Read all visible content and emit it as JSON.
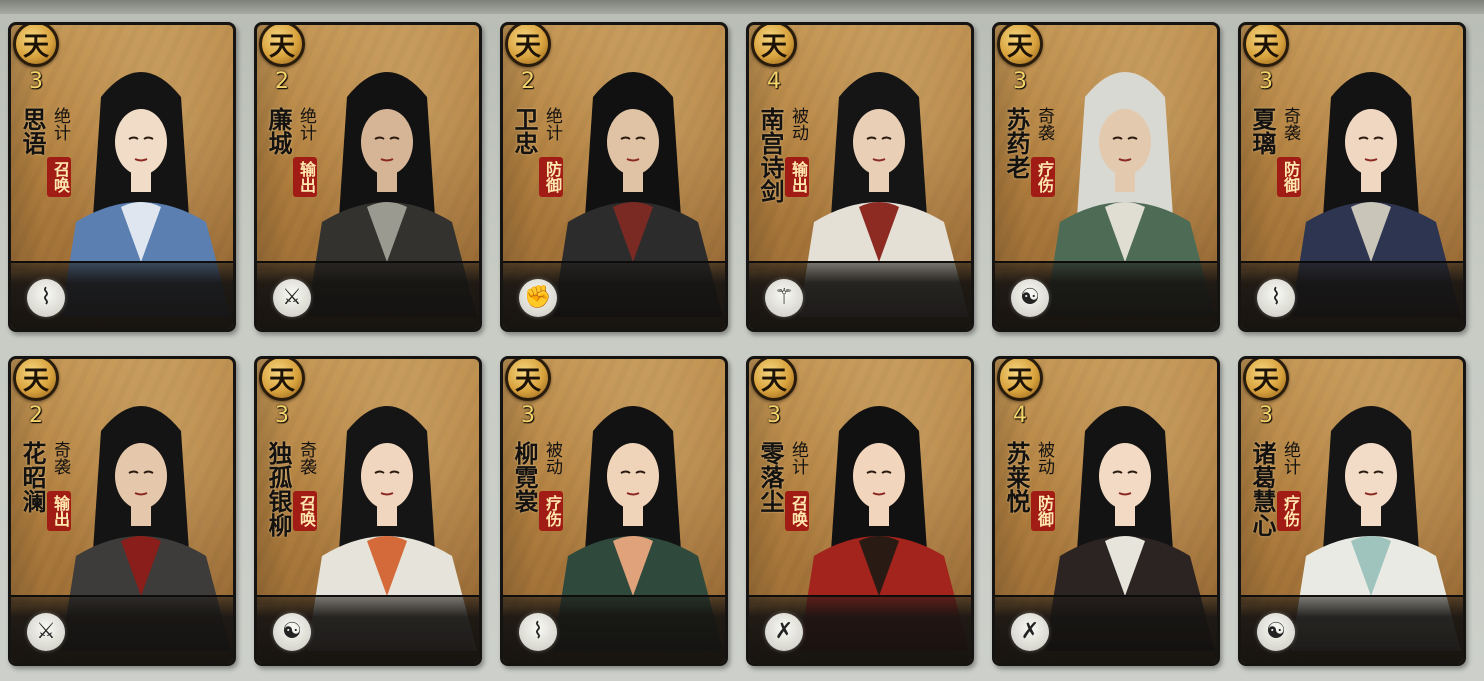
{
  "grade_label": "天",
  "cards": [
    {
      "name": "思语",
      "cost": "3",
      "skill": "绝计",
      "role": "召唤",
      "role_style": "red",
      "weapon_icon": "zither-icon",
      "weapon_glyph": "⌇",
      "robe": "#5a7fb0",
      "robe2": "#dfe6f0",
      "hair": "#141414",
      "skin": "#f1dcc7"
    },
    {
      "name": "廉城",
      "cost": "2",
      "skill": "绝计",
      "role": "输出",
      "role_style": "red",
      "weapon_icon": "dual-blade-icon",
      "weapon_glyph": "⚔",
      "robe": "#33322e",
      "robe2": "#9a9a90",
      "hair": "#121212",
      "skin": "#d6b596"
    },
    {
      "name": "卫忠",
      "cost": "2",
      "skill": "绝计",
      "role": "防御",
      "role_style": "red",
      "weapon_icon": "fist-icon",
      "weapon_glyph": "✊",
      "robe": "#2c2c2c",
      "robe2": "#7a2a22",
      "hair": "#111111",
      "skin": "#e0c2a4"
    },
    {
      "name": "南宫诗剑",
      "cost": "4",
      "skill": "被动",
      "role": "输出",
      "role_style": "red",
      "weapon_icon": "sword-icon",
      "weapon_glyph": "⚚",
      "robe": "#e4e0d6",
      "robe2": "#8d2a22",
      "hair": "#151515",
      "skin": "#e8cfb6"
    },
    {
      "name": "苏药老",
      "cost": "3",
      "skill": "奇袭",
      "role": "疗伤",
      "role_style": "red",
      "weapon_icon": "palm-icon",
      "weapon_glyph": "☯",
      "robe": "#4d6b55",
      "robe2": "#e0ddd2",
      "hair": "#d9d9d4",
      "skin": "#e3c9ad"
    },
    {
      "name": "夏璃",
      "cost": "3",
      "skill": "奇袭",
      "role": "防御",
      "role_style": "red",
      "weapon_icon": "zither-icon",
      "weapon_glyph": "⌇",
      "robe": "#2e3550",
      "robe2": "#c9c5b8",
      "hair": "#131313",
      "skin": "#efd7c2"
    },
    {
      "name": "花昭澜",
      "cost": "2",
      "skill": "奇袭",
      "role": "输出",
      "role_style": "red",
      "weapon_icon": "dual-blade-icon",
      "weapon_glyph": "⚔",
      "robe": "#3e3c3a",
      "robe2": "#8a1e1a",
      "hair": "#141414",
      "skin": "#e5c8ab"
    },
    {
      "name": "独孤银柳",
      "cost": "3",
      "skill": "奇袭",
      "role": "召唤",
      "role_style": "red",
      "weapon_icon": "palm-icon",
      "weapon_glyph": "☯",
      "robe": "#e6e3da",
      "robe2": "#d46a3a",
      "hair": "#151515",
      "skin": "#f0d6bf"
    },
    {
      "name": "柳霓裳",
      "cost": "3",
      "skill": "被动",
      "role": "疗伤",
      "role_style": "red",
      "weapon_icon": "zither-icon",
      "weapon_glyph": "⌇",
      "robe": "#2f4a3c",
      "robe2": "#e0a27a",
      "hair": "#121212",
      "skin": "#f0d4b9"
    },
    {
      "name": "零落尘",
      "cost": "3",
      "skill": "绝计",
      "role": "召唤",
      "role_style": "red",
      "weapon_icon": "crossed-blades-icon",
      "weapon_glyph": "✗",
      "robe": "#a3231d",
      "robe2": "#2a1a14",
      "hair": "#111111",
      "skin": "#f1d6bd"
    },
    {
      "name": "苏莱悦",
      "cost": "4",
      "skill": "被动",
      "role": "防御",
      "role_style": "red",
      "weapon_icon": "crossed-blades-icon",
      "weapon_glyph": "✗",
      "robe": "#2b2422",
      "robe2": "#e7e4dc",
      "hair": "#131313",
      "skin": "#f2dac4"
    },
    {
      "name": "诸葛慧心",
      "cost": "3",
      "skill": "绝计",
      "role": "疗伤",
      "role_style": "red",
      "weapon_icon": "palm-icon",
      "weapon_glyph": "☯",
      "robe": "#e9eae4",
      "robe2": "#9fc3bd",
      "hair": "#151515",
      "skin": "#f2dcc8"
    }
  ]
}
